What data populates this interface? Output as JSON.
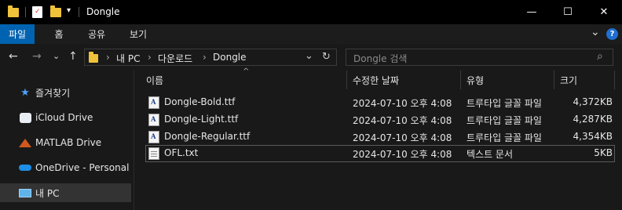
{
  "window": {
    "title": "Dongle",
    "controls": {
      "minimize": "—",
      "maximize": "☐",
      "close": "✕"
    }
  },
  "quick_access": {
    "dropdown": "▾"
  },
  "ribbon": {
    "tabs": [
      {
        "label": "파일",
        "active": true
      },
      {
        "label": "홈"
      },
      {
        "label": "공유"
      },
      {
        "label": "보기"
      }
    ],
    "expand_icon": "⌄",
    "help_icon": "?"
  },
  "address": {
    "breadcrumbs": [
      "내 PC",
      "다운로드",
      "Dongle"
    ],
    "separator": "›",
    "dropdown": "⌄",
    "refresh": "↻"
  },
  "search": {
    "placeholder": "Dongle 검색",
    "icon": "⌕"
  },
  "nav": {
    "back": "←",
    "forward": "→",
    "recent": "⌄",
    "up": "↑"
  },
  "sidebar": {
    "items": [
      {
        "label": "즐겨찾기",
        "icon": "star-icon"
      },
      {
        "label": "iCloud Drive",
        "icon": "icloud-icon"
      },
      {
        "label": "MATLAB Drive",
        "icon": "matlab-icon"
      },
      {
        "label": "OneDrive - Personal",
        "icon": "onedrive-icon"
      },
      {
        "label": "내 PC",
        "icon": "computer-icon",
        "selected": true
      }
    ]
  },
  "columns": {
    "name": "이름",
    "modified": "수정한 날짜",
    "type": "유형",
    "size": "크기",
    "sort_indicator": "^"
  },
  "files": [
    {
      "name": "Dongle-Bold.ttf",
      "modified": "2024-07-10 오후 4:08",
      "type": "트루타입 글꼴 파일",
      "size": "4,372KB",
      "icon": "font-file-icon"
    },
    {
      "name": "Dongle-Light.ttf",
      "modified": "2024-07-10 오후 4:08",
      "type": "트루타입 글꼴 파일",
      "size": "4,287KB",
      "icon": "font-file-icon"
    },
    {
      "name": "Dongle-Regular.ttf",
      "modified": "2024-07-10 오후 4:08",
      "type": "트루타입 글꼴 파일",
      "size": "4,354KB",
      "icon": "font-file-icon"
    },
    {
      "name": "OFL.txt",
      "modified": "2024-07-10 오후 4:08",
      "type": "텍스트 문서",
      "size": "5KB",
      "icon": "text-file-icon",
      "focused": true
    }
  ],
  "colors": {
    "accent": "#0063b1",
    "folder": "#f0c23a",
    "background": "#191919"
  }
}
